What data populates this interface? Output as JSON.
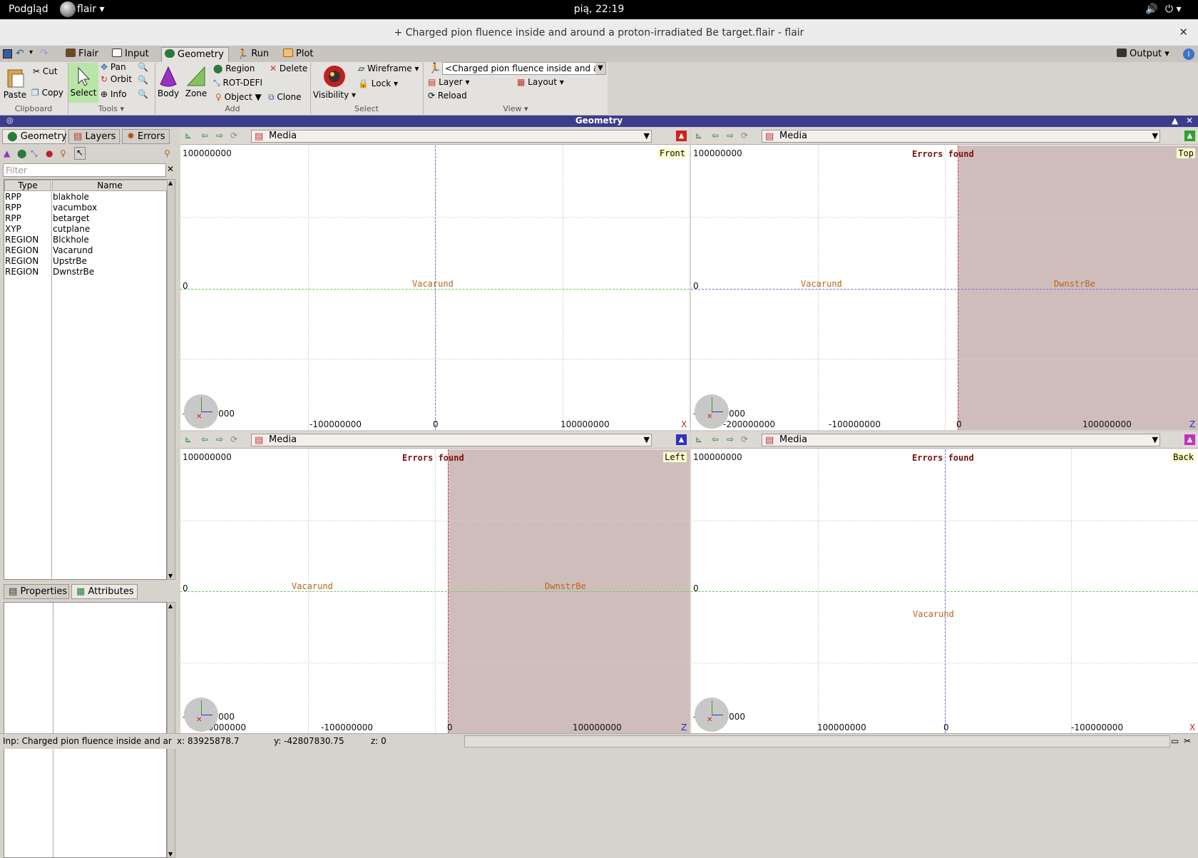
{
  "topbar": {
    "app": "Podgląd",
    "flair": "flair",
    "clock": "pią, 22:19"
  },
  "window": {
    "title": "+ Charged pion fluence inside and around a proton-irradiated Be target.flair - flair"
  },
  "tabs": [
    {
      "label": "Flair"
    },
    {
      "label": "Input"
    },
    {
      "label": "Geometry"
    },
    {
      "label": "Run"
    },
    {
      "label": "Plot"
    }
  ],
  "output_label": "Output",
  "ribbon": {
    "clipboard": {
      "paste": "Paste",
      "cut": "Cut",
      "copy": "Copy",
      "group": "Clipboard"
    },
    "tools": {
      "select": "Select",
      "pan": "Pan",
      "orbit": "Orbit",
      "info": "Info",
      "group": "Tools"
    },
    "add": {
      "body": "Body",
      "zone": "Zone",
      "region": "Region",
      "rotdefi": "ROT-DEFI",
      "object": "Object",
      "delete": "Delete",
      "clone": "Clone",
      "group": "Add"
    },
    "select": {
      "visibility": "Visibility",
      "wireframe": "Wireframe",
      "lock": "Lock",
      "group": "Select"
    },
    "view": {
      "combo": "<Charged pion fluence inside and arc",
      "layer": "Layer",
      "layout": "Layout",
      "reload": "Reload",
      "group": "View"
    }
  },
  "geometry_header": "Geometry",
  "left_tabs": [
    {
      "label": "Geometry"
    },
    {
      "label": "Layers"
    },
    {
      "label": "Errors"
    }
  ],
  "filter_placeholder": "Filter",
  "table": {
    "headers": [
      "Type",
      "Name"
    ],
    "rows": [
      {
        "type": "RPP",
        "name": "blakhole"
      },
      {
        "type": "RPP",
        "name": "vacumbox"
      },
      {
        "type": "RPP",
        "name": "betarget"
      },
      {
        "type": "XYP",
        "name": "cutplane"
      },
      {
        "type": "REGION",
        "name": "Blckhole"
      },
      {
        "type": "REGION",
        "name": "Vacarund"
      },
      {
        "type": "REGION",
        "name": "UpstrBe"
      },
      {
        "type": "REGION",
        "name": "DwnstrBe"
      }
    ]
  },
  "lower_tabs": [
    {
      "label": "Properties"
    },
    {
      "label": "Attributes"
    }
  ],
  "viewports": [
    {
      "layer": "Media",
      "name": "Front",
      "error": "",
      "ytop": "100000000",
      "yzero": "0",
      "ybot": "-100000000",
      "x1": "-100000000",
      "x2": "0",
      "x3": "100000000",
      "regionA": "Vacarund",
      "regionB": "",
      "axis_end": "X"
    },
    {
      "layer": "Media",
      "name": "Top",
      "error": "Errors found",
      "ytop": "100000000",
      "yzero": "0",
      "ybot": "-100000000",
      "x1": "-200000000",
      "x2": "-100000000",
      "x3": "0",
      "x4": "100000000",
      "regionA": "Vacarund",
      "regionB": "DwnstrBe",
      "axis_end": "Z"
    },
    {
      "layer": "Media",
      "name": "Left",
      "error": "Errors found",
      "ytop": "100000000",
      "yzero": "0",
      "ybot": "-100000000",
      "x1": "-200000000",
      "x2": "-100000000",
      "x3": "0",
      "x4": "100000000",
      "regionA": "Vacarund",
      "regionB": "DwnstrBe",
      "axis_end": "Z"
    },
    {
      "layer": "Media",
      "name": "Back",
      "error": "Errors found",
      "ytop": "100000000",
      "yzero": "0",
      "ybot": "-100000000",
      "x1": "100000000",
      "x2": "0",
      "x3": "-100000000",
      "regionA": "Vacarund",
      "regionB": "",
      "axis_end": "X"
    }
  ],
  "status": {
    "msg": "Inp: Charged pion fluence inside and ar",
    "x": "x: 83925878.7",
    "y": "y: -42807830.75",
    "z": "z: 0"
  },
  "colors": {
    "accent": "#3c3c8c",
    "error_area": "#cfbdbc",
    "region_label": "#b8651a"
  }
}
